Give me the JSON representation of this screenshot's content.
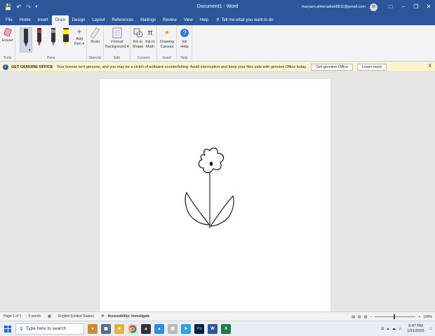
{
  "window": {
    "title": "Document1 - Word",
    "account_email": "maryam.almeradian8811@gmail.com",
    "avatar_initials": "M"
  },
  "tabs": [
    "File",
    "Home",
    "Insert",
    "Draw",
    "Design",
    "Layout",
    "References",
    "Mailings",
    "Review",
    "View",
    "Help"
  ],
  "tell_me": "Tell me what you want to do",
  "ribbon": {
    "tools": {
      "label": "Tools",
      "eraser": "Eraser"
    },
    "pens": {
      "label": "Pens",
      "add_pen_line1": "Add",
      "add_pen_line2": "Pen"
    },
    "stencils": {
      "label": "Stencils",
      "ruler": "Ruler"
    },
    "edit": {
      "label": "Edit",
      "format_bg_line1": "Format",
      "format_bg_line2": "Background"
    },
    "convert": {
      "label": "Convert",
      "ink_shape_line1": "Ink to",
      "ink_shape_line2": "Shape",
      "ink_math_line1": "Ink to",
      "ink_math_line2": "Math"
    },
    "insert": {
      "label": "Insert",
      "canvas_line1": "Drawing",
      "canvas_line2": "Canvas"
    },
    "help": {
      "label": "Help",
      "ink_help_line1": "Ink",
      "ink_help_line2": "Help"
    }
  },
  "message_bar": {
    "heading": "GET GENUINE OFFICE",
    "text": "Your license isn't genuine, and you may be a victim of software counterfeiting. Avoid interruption and keep your files safe with genuine Office today.",
    "primary_button": "Get genuine Office",
    "secondary_button": "Learn more",
    "close": "X"
  },
  "status_bar": {
    "page": "Page 1 of 1",
    "words": "0 words",
    "language": "English (United States)",
    "accessibility": "Accessibility: Investigate",
    "zoom": "100%"
  },
  "taskbar": {
    "search_placeholder": "Type here to search",
    "time": "6:47 PM",
    "date": "1/21/2025"
  },
  "colors": {
    "word_blue": "#2b579a",
    "message_bar": "#fff4ce"
  }
}
